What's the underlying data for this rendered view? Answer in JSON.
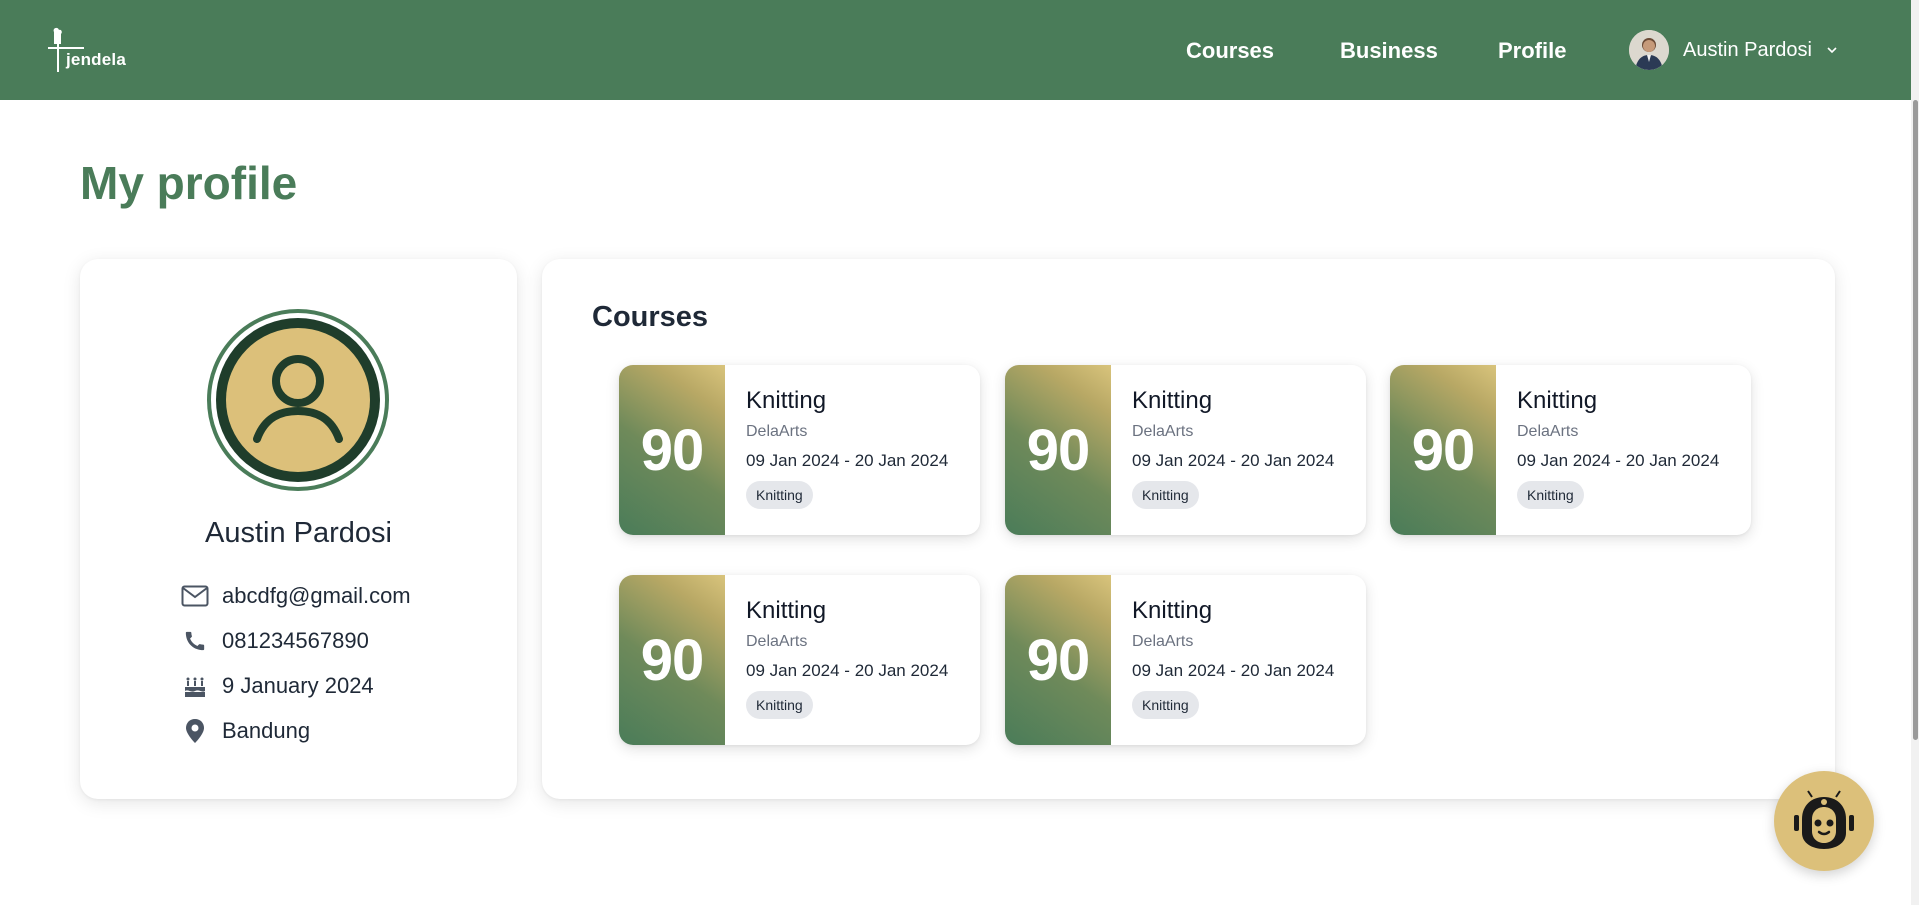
{
  "header": {
    "logo_text": "jendela",
    "nav": {
      "courses": "Courses",
      "business": "Business",
      "profile": "Profile"
    },
    "user_name": "Austin Pardosi"
  },
  "page_title": "My profile",
  "profile": {
    "name": "Austin Pardosi",
    "email": "abcdfg@gmail.com",
    "phone": "081234567890",
    "birthday": "9 January 2024",
    "location": "Bandung"
  },
  "courses_section": {
    "title": "Courses",
    "items": [
      {
        "score": "90",
        "name": "Knitting",
        "provider": "DelaArts",
        "dates": "09 Jan 2024 - 20 Jan 2024",
        "tag": "Knitting"
      },
      {
        "score": "90",
        "name": "Knitting",
        "provider": "DelaArts",
        "dates": "09 Jan 2024 - 20 Jan 2024",
        "tag": "Knitting"
      },
      {
        "score": "90",
        "name": "Knitting",
        "provider": "DelaArts",
        "dates": "09 Jan 2024 - 20 Jan 2024",
        "tag": "Knitting"
      },
      {
        "score": "90",
        "name": "Knitting",
        "provider": "DelaArts",
        "dates": "09 Jan 2024 - 20 Jan 2024",
        "tag": "Knitting"
      },
      {
        "score": "90",
        "name": "Knitting",
        "provider": "DelaArts",
        "dates": "09 Jan 2024 - 20 Jan 2024",
        "tag": "Knitting"
      }
    ]
  },
  "icons": {
    "email": "mail-icon",
    "phone": "phone-icon",
    "birthday": "cake-icon",
    "location": "map-pin-icon",
    "chatbot": "robot-icon"
  },
  "colors": {
    "brand_green": "#4a7c59",
    "accent_gold": "#dcc07a",
    "dark_green": "#1f3d2b"
  }
}
